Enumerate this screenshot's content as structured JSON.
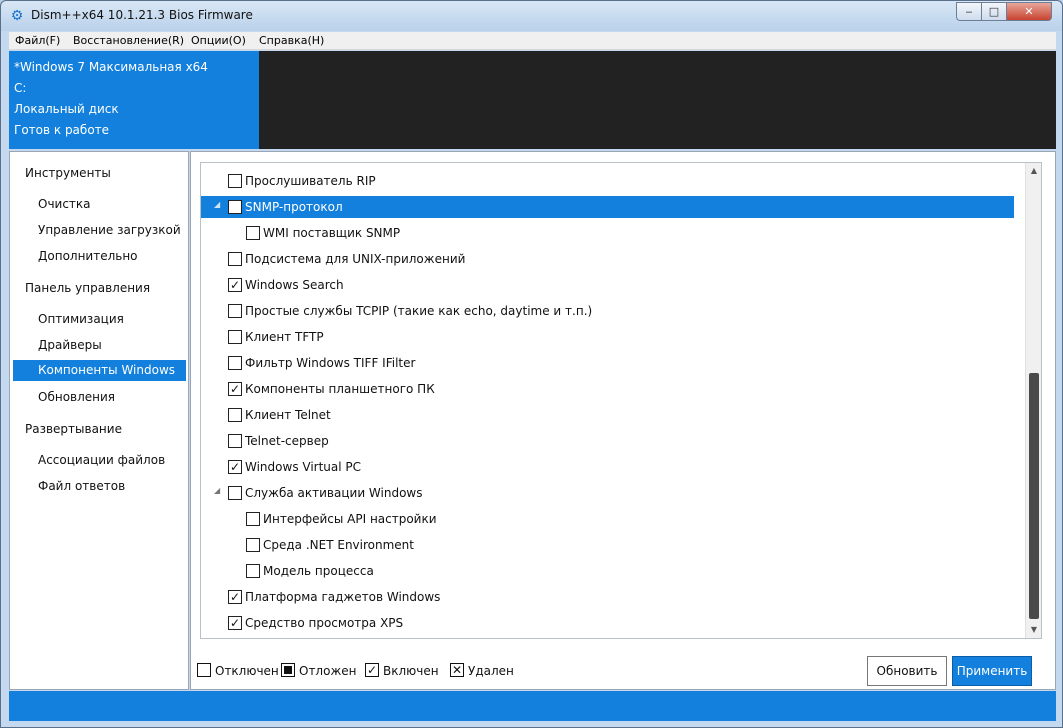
{
  "window": {
    "title": "Dism++x64 10.1.21.3 Bios Firmware",
    "minimize": "‒",
    "maximize": "□",
    "close": "✕"
  },
  "menu": [
    {
      "label": "Файл(F)"
    },
    {
      "label": "Восстановление(R)"
    },
    {
      "label": "Опции(O)"
    },
    {
      "label": "Справка(H)"
    }
  ],
  "info": {
    "os": "*Windows 7 Максимальная x64",
    "drive": "C:",
    "disk": "Локальный диск",
    "status": "Готов к работе"
  },
  "sidebar": {
    "groups": [
      {
        "label": "Инструменты",
        "items": [
          "Очистка",
          "Управление загрузкой",
          "Дополнительно"
        ]
      },
      {
        "label": "Панель управления",
        "items": [
          "Оптимизация",
          "Драйверы",
          "Компоненты Windows",
          "Обновления"
        ]
      },
      {
        "label": "Развертывание",
        "items": [
          "Ассоциации файлов",
          "Файл ответов"
        ]
      }
    ],
    "active": "Компоненты Windows"
  },
  "components": [
    {
      "label": "Прослушиватель RIP",
      "state": "off",
      "level": 0
    },
    {
      "label": "SNMP-протокол",
      "state": "off",
      "level": 0,
      "expanded": true,
      "selected": true
    },
    {
      "label": "WMI поставщик SNMP",
      "state": "off",
      "level": 1
    },
    {
      "label": "Подсистема для UNIX-приложений",
      "state": "off",
      "level": 0
    },
    {
      "label": "Windows Search",
      "state": "on",
      "level": 0
    },
    {
      "label": "Простые службы TCPIP (такие как echo, daytime и т.п.)",
      "state": "off",
      "level": 0
    },
    {
      "label": "Клиент TFTP",
      "state": "off",
      "level": 0
    },
    {
      "label": "Фильтр Windows TIFF IFilter",
      "state": "off",
      "level": 0
    },
    {
      "label": "Компоненты планшетного ПК",
      "state": "on",
      "level": 0
    },
    {
      "label": "Клиент Telnet",
      "state": "off",
      "level": 0
    },
    {
      "label": "Telnet-сервер",
      "state": "off",
      "level": 0
    },
    {
      "label": "Windows Virtual PC",
      "state": "on",
      "level": 0
    },
    {
      "label": "Служба активации Windows",
      "state": "off",
      "level": 0,
      "expanded": true
    },
    {
      "label": "Интерфейсы API настройки",
      "state": "off",
      "level": 1
    },
    {
      "label": "Среда .NET Environment",
      "state": "off",
      "level": 1
    },
    {
      "label": "Модель процесса",
      "state": "off",
      "level": 1
    },
    {
      "label": "Платформа гаджетов Windows",
      "state": "on",
      "level": 0
    },
    {
      "label": "Средство просмотра XPS",
      "state": "on",
      "level": 0
    }
  ],
  "legend": {
    "disabled": "Отключен",
    "pending": "Отложен",
    "enabled": "Включен",
    "removed": "Удален"
  },
  "buttons": {
    "refresh": "Обновить",
    "apply": "Применить"
  },
  "colors": {
    "accent": "#1280dc",
    "dark_panel": "#222222"
  },
  "icons": {
    "app": "gear-icon",
    "check": "check-icon",
    "expander": "triangle-expander-icon"
  }
}
